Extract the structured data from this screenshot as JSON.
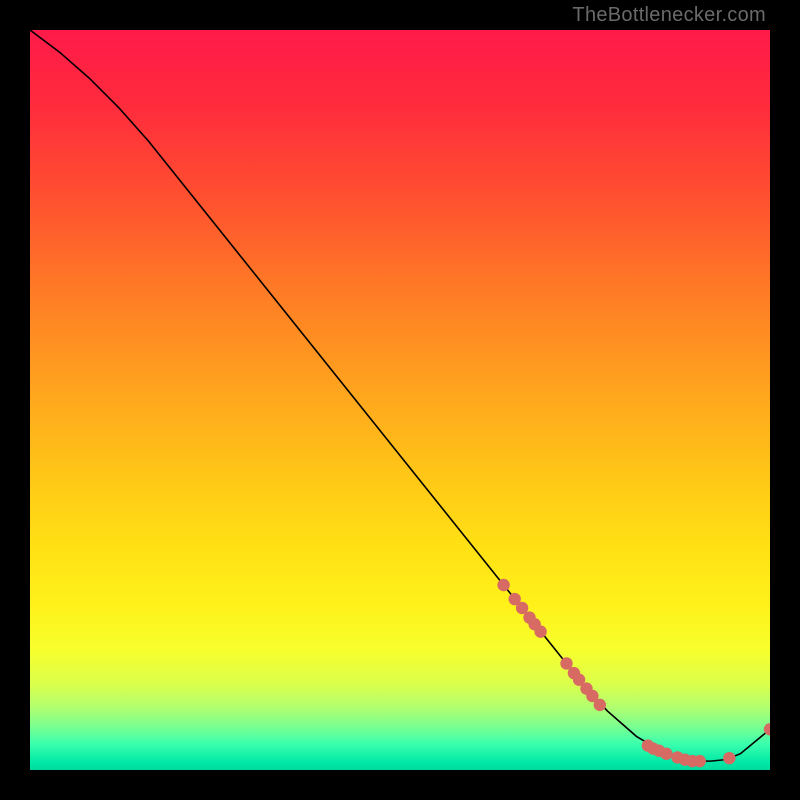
{
  "watermark": "TheBottlenecker.com",
  "gradient_stops": [
    {
      "offset": 0.0,
      "color": "#ff1a49"
    },
    {
      "offset": 0.1,
      "color": "#ff2b3d"
    },
    {
      "offset": 0.22,
      "color": "#ff4e30"
    },
    {
      "offset": 0.35,
      "color": "#ff7a26"
    },
    {
      "offset": 0.48,
      "color": "#ffa21e"
    },
    {
      "offset": 0.6,
      "color": "#ffc617"
    },
    {
      "offset": 0.7,
      "color": "#ffe114"
    },
    {
      "offset": 0.78,
      "color": "#fff21a"
    },
    {
      "offset": 0.84,
      "color": "#f6ff2e"
    },
    {
      "offset": 0.885,
      "color": "#daff4d"
    },
    {
      "offset": 0.915,
      "color": "#b2ff6f"
    },
    {
      "offset": 0.94,
      "color": "#7dff8f"
    },
    {
      "offset": 0.965,
      "color": "#3affad"
    },
    {
      "offset": 0.99,
      "color": "#00e8a6"
    },
    {
      "offset": 1.0,
      "color": "#00d99d"
    }
  ],
  "chart_data": {
    "type": "line",
    "title": "",
    "xlabel": "",
    "ylabel": "",
    "xlim": [
      0,
      100
    ],
    "ylim": [
      0,
      100
    ],
    "series": [
      {
        "name": "curve",
        "x": [
          0,
          4,
          8,
          12,
          16,
          20,
          26,
          32,
          38,
          44,
          50,
          56,
          62,
          66,
          70,
          74,
          78,
          82,
          86,
          88,
          90,
          92,
          94,
          96,
          100
        ],
        "y": [
          100,
          97,
          93.5,
          89.5,
          85,
          80,
          72.5,
          65,
          57.5,
          50,
          42.5,
          35,
          27.5,
          22.5,
          17.5,
          12.5,
          8,
          4.5,
          2.2,
          1.5,
          1.2,
          1.2,
          1.4,
          2.2,
          5.5
        ]
      }
    ],
    "markers": [
      {
        "x": 64.0,
        "y": 25.0
      },
      {
        "x": 65.5,
        "y": 23.1
      },
      {
        "x": 66.5,
        "y": 21.9
      },
      {
        "x": 67.5,
        "y": 20.6
      },
      {
        "x": 68.2,
        "y": 19.7
      },
      {
        "x": 69.0,
        "y": 18.7
      },
      {
        "x": 72.5,
        "y": 14.4
      },
      {
        "x": 73.5,
        "y": 13.1
      },
      {
        "x": 74.2,
        "y": 12.2
      },
      {
        "x": 75.2,
        "y": 11.0
      },
      {
        "x": 76.0,
        "y": 10.0
      },
      {
        "x": 77.0,
        "y": 8.8
      },
      {
        "x": 83.5,
        "y": 3.3
      },
      {
        "x": 84.2,
        "y": 2.9
      },
      {
        "x": 85.0,
        "y": 2.6
      },
      {
        "x": 86.0,
        "y": 2.2
      },
      {
        "x": 87.5,
        "y": 1.7
      },
      {
        "x": 88.5,
        "y": 1.4
      },
      {
        "x": 89.5,
        "y": 1.2
      },
      {
        "x": 90.5,
        "y": 1.2
      },
      {
        "x": 94.5,
        "y": 1.6
      },
      {
        "x": 100.0,
        "y": 5.5
      }
    ],
    "marker_color": "#d76a63",
    "marker_radius": 6.2,
    "curve_color": "#000000",
    "curve_width": 1.6
  }
}
